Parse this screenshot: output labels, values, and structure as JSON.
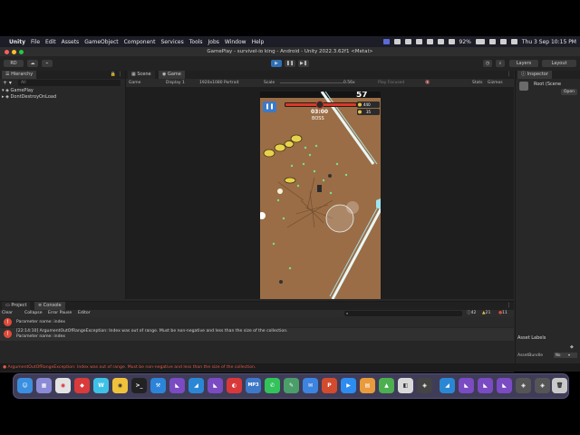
{
  "menubar": {
    "app": "Unity",
    "items": [
      "File",
      "Edit",
      "Assets",
      "GameObject",
      "Component",
      "Services",
      "Tools",
      "Jobs",
      "Window",
      "Help"
    ],
    "battery": "92%",
    "datetime": "Thu 3 Sep  10:15 PM"
  },
  "window": {
    "title": "GamePlay - survivel-io king - Android - Unity 2022.3.62f1 <Metal>"
  },
  "toolbar": {
    "account": "RD",
    "layers": "Layers",
    "layout": "Layout"
  },
  "hierarchy": {
    "tab": "Hierarchy",
    "search_placeholder": "All",
    "items": [
      "GamePlay",
      "DontDestroyOnLoad"
    ]
  },
  "game_panel": {
    "tabs": [
      "Scene",
      "Game"
    ],
    "mode": "Game",
    "display": "Display 1",
    "resolution": "1920x1080 Portrait",
    "scale_label": "Scale",
    "scale_value": "0.56x",
    "play_focused": "Play Focused",
    "stats": "Stats",
    "gizmos": "Gizmos"
  },
  "game_hud": {
    "kill_count": "57",
    "timer": "03:00",
    "boss_label": "BOSS",
    "coins": "440",
    "gems": "35"
  },
  "inspector": {
    "tab": "Inspector",
    "object": "Root (Scene",
    "open_label": "Open",
    "asset_labels": "Asset Labels",
    "asset_bundle": "AssetBundle",
    "asset_bundle_value": "No"
  },
  "console": {
    "tabs": [
      "Project",
      "Console"
    ],
    "buttons": [
      "Clear",
      "Collapse",
      "Error Pause",
      "Editor"
    ],
    "counts": {
      "log": "42",
      "warn": "21",
      "error": "11"
    },
    "entries": [
      {
        "line1": "Parameter name: index"
      },
      {
        "line1": "[22:14:10] ArgumentOutOfRangeException: Index was out of range. Must be non-negative and less than the size of the collection.",
        "line2": "Parameter name: index"
      }
    ]
  },
  "statusbar": {
    "message": "ArgumentOutOfRangeException: Index was out of range. Must be non-negative and less than the size of the collection."
  },
  "dock": {
    "apps": [
      "Finder",
      "Launchpad",
      "Chrome",
      "App",
      "Webex",
      "Chrome Canary",
      "Terminal",
      "Xcode",
      "VS",
      "VS Code",
      "Vectorworks",
      "MP3",
      "WhatsApp",
      "Notes",
      "Mail",
      "PowerPoint",
      "Zoom",
      "Pages",
      "Android",
      "App",
      "Unity Hub",
      "VS Code",
      "VS",
      "VS",
      "Unity",
      "Unity",
      "Trash"
    ]
  },
  "colors": {
    "accent_blue": "#2e6fb5",
    "error_red": "#e04b3a",
    "ground": "#9a6d46"
  }
}
